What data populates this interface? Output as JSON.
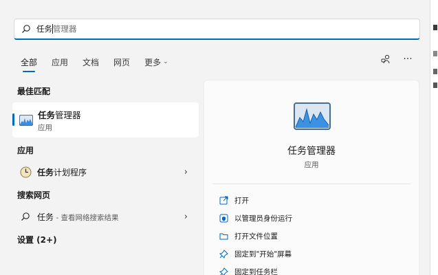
{
  "search": {
    "typed": "任务",
    "rest": "管理器"
  },
  "tabs": [
    {
      "label": "全部",
      "active": true
    },
    {
      "label": "应用",
      "active": false
    },
    {
      "label": "文档",
      "active": false
    },
    {
      "label": "网页",
      "active": false
    },
    {
      "label": "更多",
      "active": false
    }
  ],
  "sections": {
    "best_match": "最佳匹配",
    "apps": "应用",
    "web": "搜索网页",
    "settings": "设置 (2+)"
  },
  "best_match": {
    "name_bold": "任务",
    "name_rest": "管理器",
    "sub": "应用"
  },
  "apps": {
    "item_bold": "任务",
    "item_rest": "计划程序"
  },
  "web": {
    "item_main": "任务",
    "item_dim": " - 查看网络搜索结果"
  },
  "detail": {
    "name": "任务管理器",
    "sub": "应用",
    "actions": [
      {
        "label": "打开",
        "icon": "open-icon"
      },
      {
        "label": "以管理员身份运行",
        "icon": "admin-shield-icon"
      },
      {
        "label": "打开文件位置",
        "icon": "folder-icon"
      },
      {
        "label": "固定到\"开始\"屏幕",
        "icon": "pin-icon"
      },
      {
        "label": "固定到任务栏",
        "icon": "pin-icon"
      }
    ]
  },
  "colors": {
    "accent": "#0067c0",
    "panel": "#f3f3f3"
  }
}
